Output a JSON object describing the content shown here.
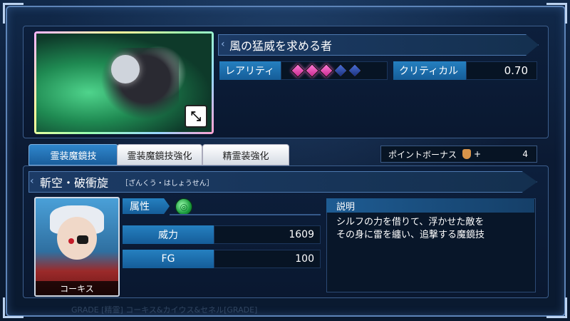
{
  "card": {
    "title": "風の猛威を求める者",
    "rarity_label": "レアリティ",
    "rarity": {
      "filled": 3,
      "total": 5
    },
    "critical_label": "クリティカル",
    "critical_value": "0.70",
    "expand_icon": "expand-arrows-icon"
  },
  "tabs": [
    {
      "label": "霊装魔鏡技",
      "active": true
    },
    {
      "label": "霊装魔鏡技強化",
      "active": false
    },
    {
      "label": "精霊装強化",
      "active": false
    }
  ],
  "point_bonus": {
    "label": "ポイントボーナス",
    "plus": "+",
    "value": "4",
    "icon": "bag-icon"
  },
  "skill": {
    "name": "斬空・破衝旋",
    "reading": "［ざんくう・はしょうせん］",
    "character_name": "コーキス",
    "attribute_label": "属性",
    "attribute_icon": "wind-element-icon",
    "power_label": "威力",
    "power_value": "1609",
    "fg_label": "FG",
    "fg_value": "100",
    "description_label": "説明",
    "description": "シルフの力を借りて、浮かせた敵を\nその身に雷を纏い、追撃する魔鏡技"
  },
  "footer": "GRADE [精霊] コーキス&カイウス&セネル[GRADE]",
  "colors": {
    "accent": "#2580c0",
    "gem_on": "#e04db0",
    "gem_off": "#3b5fd0",
    "panel": "#0a1830"
  }
}
